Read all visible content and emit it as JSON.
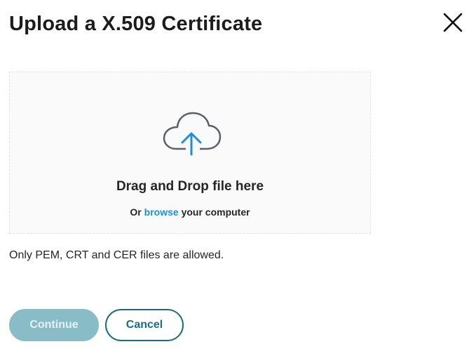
{
  "dialog": {
    "title": "Upload a X.509 Certificate",
    "close_icon": "close-icon"
  },
  "dropzone": {
    "icon": "cloud-upload-icon",
    "heading": "Drag and Drop file here",
    "sub_prefix": "Or",
    "browse_label": "browse",
    "sub_suffix": "your computer"
  },
  "hint": "Only PEM, CRT and CER files are allowed.",
  "actions": {
    "continue_label": "Continue",
    "continue_disabled": true,
    "cancel_label": "Cancel"
  },
  "colors": {
    "accent": "#1b90d6",
    "primary": "#1a6c80",
    "primary_disabled": "#88bcc6"
  }
}
